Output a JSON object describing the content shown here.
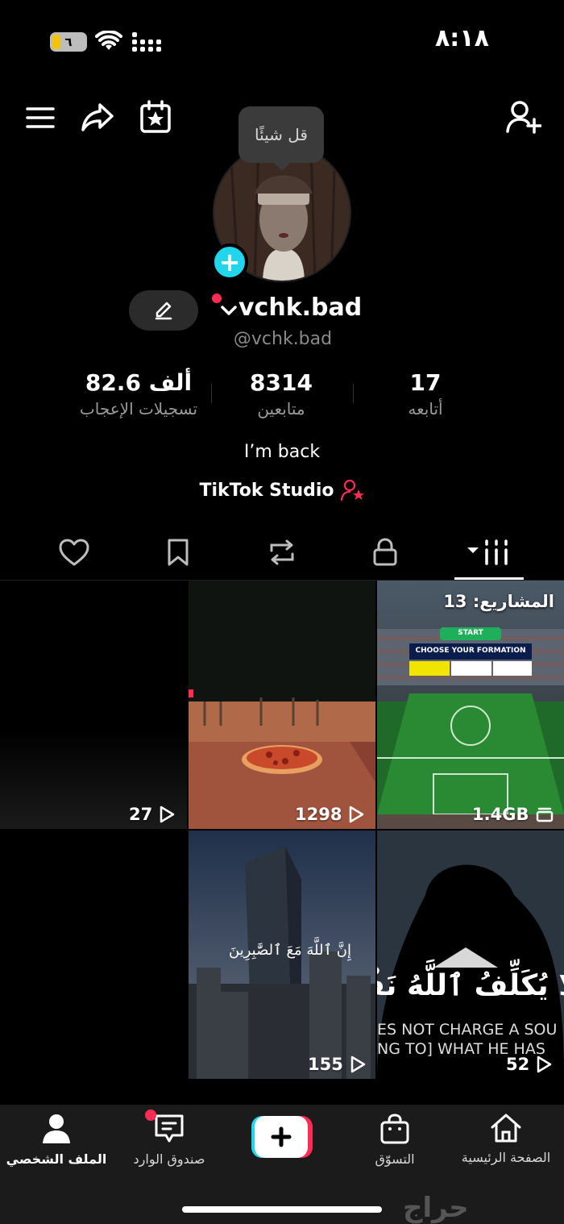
{
  "status_bar": {
    "time": "٨:١٨",
    "battery": "٦"
  },
  "header": {
    "tooltip": "قل شيئًا"
  },
  "profile": {
    "username": "vchk.bad",
    "handle": "@vchk.bad",
    "bio": "I’m back",
    "studio_link": "TikTok Studio"
  },
  "stats": [
    {
      "value": "17",
      "label": "أتابعه"
    },
    {
      "value": "8314",
      "label": "متابعين"
    },
    {
      "value": "82.6 ألف",
      "label": "تسجيلات الإعجاب"
    }
  ],
  "grid": {
    "drafts_label": "المشاريع: 13",
    "storage": "1.4GB",
    "video_views": [
      "27",
      "1298",
      "155",
      "52"
    ],
    "formation_start": "START",
    "formation_title": "CHOOSE YOUR FORMATION",
    "quran_verse_small": "إِنَّ ٱللَّهَ مَعَ ٱلصَّٰبِرِينَ",
    "quran_verse_large": "لَا يُكَلِّفُ ٱللَّهُ نَفْسًا إِلَّا",
    "quran_translation_1": "ES NOT CHARGE A SOU",
    "quran_translation_2": "NG TO] WHAT HE HAS"
  },
  "nav": {
    "home": "الصفحة الرئيسية",
    "shop": "التسوّق",
    "inbox": "صندوق الوارد",
    "profile": "الملف الشخصي"
  },
  "watermark": "حراج",
  "colors": {
    "accent_cyan": "#20d5ec",
    "accent_red": "#fe2c55",
    "background": "#000000"
  }
}
